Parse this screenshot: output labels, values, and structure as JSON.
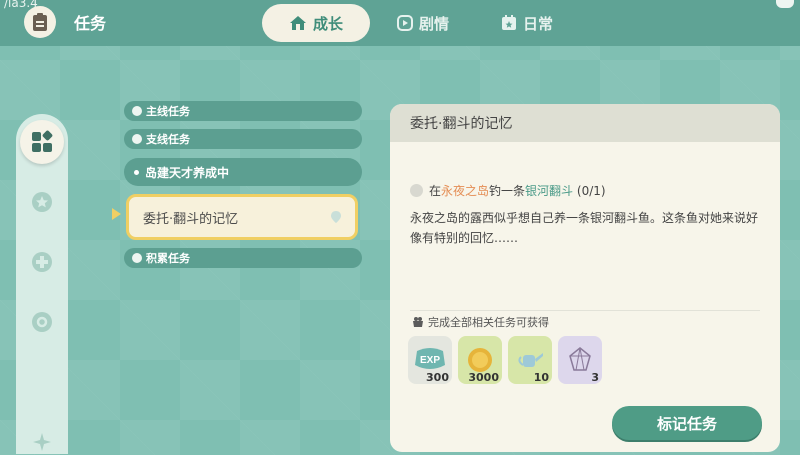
{
  "status": {
    "corner_text": "/lá3.4"
  },
  "header": {
    "title": "任务",
    "icon": "clipboard-icon"
  },
  "tabs": [
    {
      "label": "成长",
      "icon": "house-icon",
      "active": true
    },
    {
      "label": "剧情",
      "icon": "play-icon",
      "active": false
    },
    {
      "label": "日常",
      "icon": "calendar-icon",
      "active": false
    }
  ],
  "sidebar": {
    "items": [
      {
        "icon": "grid-icon",
        "active": true
      },
      {
        "icon": "star-badge-icon",
        "active": false
      },
      {
        "icon": "plus-badge-icon",
        "active": false
      },
      {
        "icon": "gear-badge-icon",
        "active": false
      },
      {
        "icon": "sparkle-icon",
        "active": false
      }
    ]
  },
  "quest_list": {
    "categories": {
      "main": "主线任务",
      "side": "支线任务",
      "accumulate": "积累任务"
    },
    "sub_category": "岛建天才养成中",
    "selected_quest": "委托·翻斗的记忆"
  },
  "detail": {
    "title": "委托·翻斗的记忆",
    "objective": {
      "prefix": "在",
      "location": "永夜之岛",
      "middle": "钓一条",
      "target": "银河翻斗",
      "progress": "(0/1)"
    },
    "description": "永夜之岛的露西似乎想自己养一条银河翻斗鱼。这条鱼对她来说好像有特别的回忆……",
    "rewards_title": "完成全部相关任务可获得",
    "rewards": [
      {
        "name": "EXP",
        "count": "300",
        "color": "#e4e6df"
      },
      {
        "name": "coin",
        "count": "3000",
        "color": "#d7e6a8"
      },
      {
        "name": "watering-can",
        "count": "10",
        "color": "#d7e6a8"
      },
      {
        "name": "crystal",
        "count": "3",
        "color": "#ddd7ec"
      }
    ],
    "button_label": "标记任务"
  },
  "colors": {
    "accent": "#4f9c86",
    "highlight_orange": "#e48d54",
    "highlight_teal": "#4a9a88",
    "selected_border": "#f0cf63"
  }
}
